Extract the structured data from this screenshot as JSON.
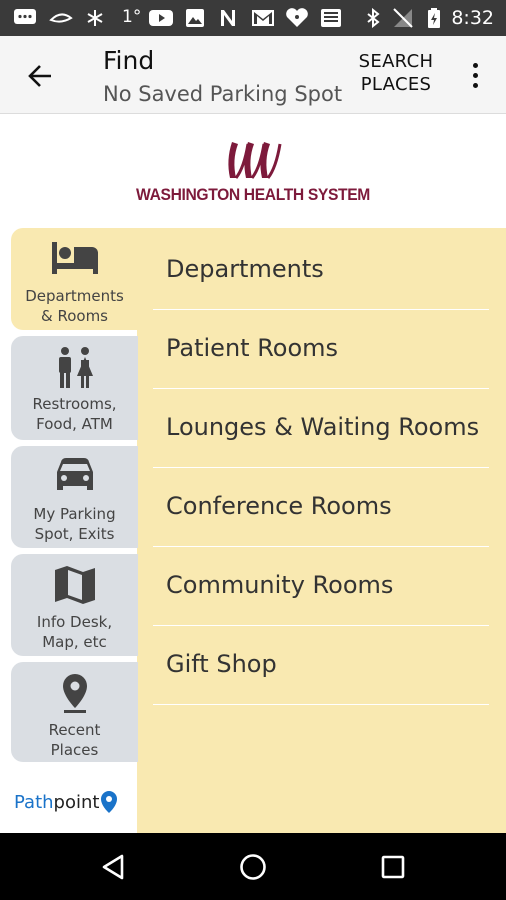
{
  "status_bar": {
    "time": "8:32",
    "temperature": "1°",
    "icons": [
      "message-icon",
      "visor-icon",
      "snowflake-icon",
      "youtube-icon",
      "photo-icon",
      "n-icon",
      "gmail-icon",
      "iheart-icon",
      "news-icon",
      "bluetooth-icon",
      "no-signal-icon",
      "battery-icon"
    ]
  },
  "app_bar": {
    "title": "Find",
    "subtitle": "No Saved Parking Spot",
    "search_label": "SEARCH\nPLACES"
  },
  "logo": {
    "text": "WASHINGTON HEALTH SYSTEM",
    "color": "#7d1a3b"
  },
  "tabs": [
    {
      "label": "Departments\n& Rooms",
      "icon": "bed-icon",
      "active": true
    },
    {
      "label": "Restrooms,\nFood, ATM",
      "icon": "restroom-icon",
      "active": false
    },
    {
      "label": "My Parking\nSpot, Exits",
      "icon": "car-icon",
      "active": false
    },
    {
      "label": "Info Desk,\nMap, etc",
      "icon": "map-icon",
      "active": false
    },
    {
      "label": "Recent\nPlaces",
      "icon": "location-pin-icon",
      "active": false
    }
  ],
  "list": [
    {
      "label": "Departments"
    },
    {
      "label": "Patient Rooms"
    },
    {
      "label": "Lounges & Waiting Rooms"
    },
    {
      "label": "Conference Rooms"
    },
    {
      "label": "Community Rooms"
    },
    {
      "label": "Gift Shop"
    }
  ],
  "brand": {
    "part1": "Path",
    "part2": "point"
  },
  "colors": {
    "panel": "#f9e9b1",
    "tab": "#dadee3",
    "status_bar": "#3a3a3a",
    "nav_bar": "#000000",
    "brand_blue": "#1a73c9"
  }
}
